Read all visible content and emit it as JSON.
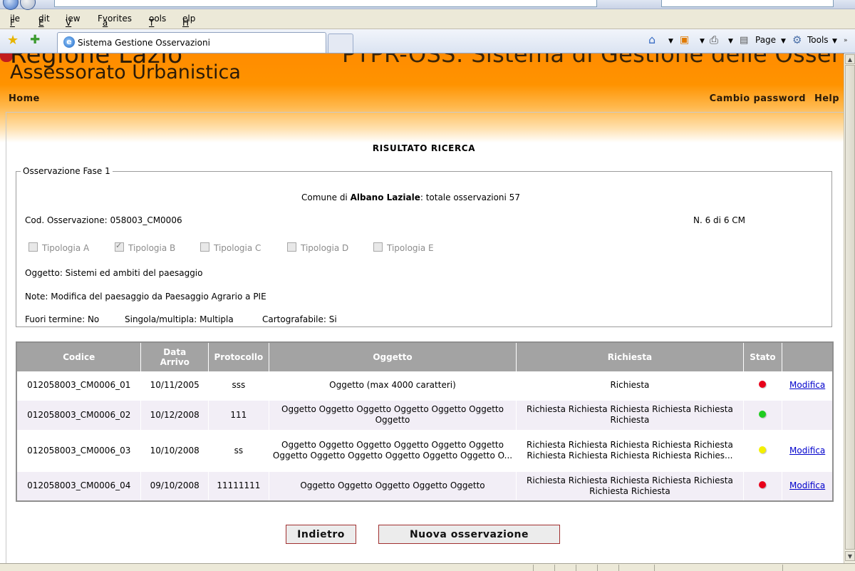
{
  "browser": {
    "menu": [
      "File",
      "Edit",
      "View",
      "Favorites",
      "Tools",
      "Help"
    ],
    "menu_underline": [
      "F",
      "E",
      "V",
      "a",
      "T",
      "H"
    ],
    "tab_title": "Sistema Gestione Osservazioni",
    "commands": {
      "page": "Page",
      "tools": "Tools"
    }
  },
  "header": {
    "brand_line1": "Regione Lazio",
    "brand_line2": "Assessorato Urbanistica",
    "system_title": "PTPR-OSS: Sistema di Gestione delle Osservazioni",
    "nav_home": "Home",
    "nav_change_password": "Cambio password",
    "nav_help": "Help"
  },
  "page": {
    "heading": "RISULTATO RICERCA",
    "fieldset_legend": "Osservazione Fase 1",
    "comune_prefix": "Comune di ",
    "comune_name": "Albano Laziale",
    "comune_suffix": ": totale osservazioni 57",
    "cod_osservazione": "Cod. Osservazione: 058003_CM0006",
    "counter": "N. 6 di 6 CM",
    "tipologie": [
      {
        "label": "Tipologia A",
        "checked": false
      },
      {
        "label": "Tipologia B",
        "checked": true
      },
      {
        "label": "Tipologia C",
        "checked": false
      },
      {
        "label": "Tipologia D",
        "checked": false
      },
      {
        "label": "Tipologia E",
        "checked": false
      }
    ],
    "oggetto": "Oggetto: Sistemi ed ambiti del paesaggio",
    "note": "Note: Modifica del paesaggio da Paesaggio Agrario a PIE",
    "fuori_termine": "Fuori termine: No",
    "singola_multipla": "Singola/multipla: Multipla",
    "cartografabile": "Cartografabile: Si"
  },
  "table": {
    "headers": {
      "codice": "Codice",
      "data_line1": "Data",
      "data_line2": "Arrivo",
      "protocollo": "Protocollo",
      "oggetto": "Oggetto",
      "richiesta": "Richiesta",
      "stato": "Stato"
    },
    "rows": [
      {
        "codice": "012058003_CM0006_01",
        "data": "10/11/2005",
        "protocollo": "sss",
        "oggetto": "Oggetto (max 4000 caratteri)",
        "richiesta": "Richiesta",
        "stato_color": "#e8001a",
        "action": "Modifica"
      },
      {
        "codice": "012058003_CM0006_02",
        "data": "10/12/2008",
        "protocollo": "111",
        "oggetto": "Oggetto Oggetto Oggetto Oggetto Oggetto Oggetto Oggetto",
        "richiesta": "Richiesta Richiesta Richiesta Richiesta Richiesta Richiesta",
        "stato_color": "#1fcc1f",
        "action": ""
      },
      {
        "codice": "012058003_CM0006_03",
        "data": "10/10/2008",
        "protocollo": "ss",
        "oggetto": "Oggetto Oggetto Oggetto Oggetto Oggetto Oggetto Oggetto Oggetto Oggetto Oggetto Oggetto Oggetto O...",
        "richiesta": "Richiesta Richiesta Richiesta Richiesta Richiesta Richiesta Richiesta Richiesta Richiesta Richies...",
        "stato_color": "#f4f000",
        "action": "Modifica"
      },
      {
        "codice": "012058003_CM0006_04",
        "data": "09/10/2008",
        "protocollo": "11111111",
        "oggetto": "Oggetto Oggetto Oggetto Oggetto Oggetto",
        "richiesta": "Richiesta Richiesta Richiesta Richiesta Richiesta Richiesta Richiesta",
        "stato_color": "#e8001a",
        "action": "Modifica"
      }
    ]
  },
  "buttons": {
    "back": "Indietro",
    "new": "Nuova osservazione"
  }
}
